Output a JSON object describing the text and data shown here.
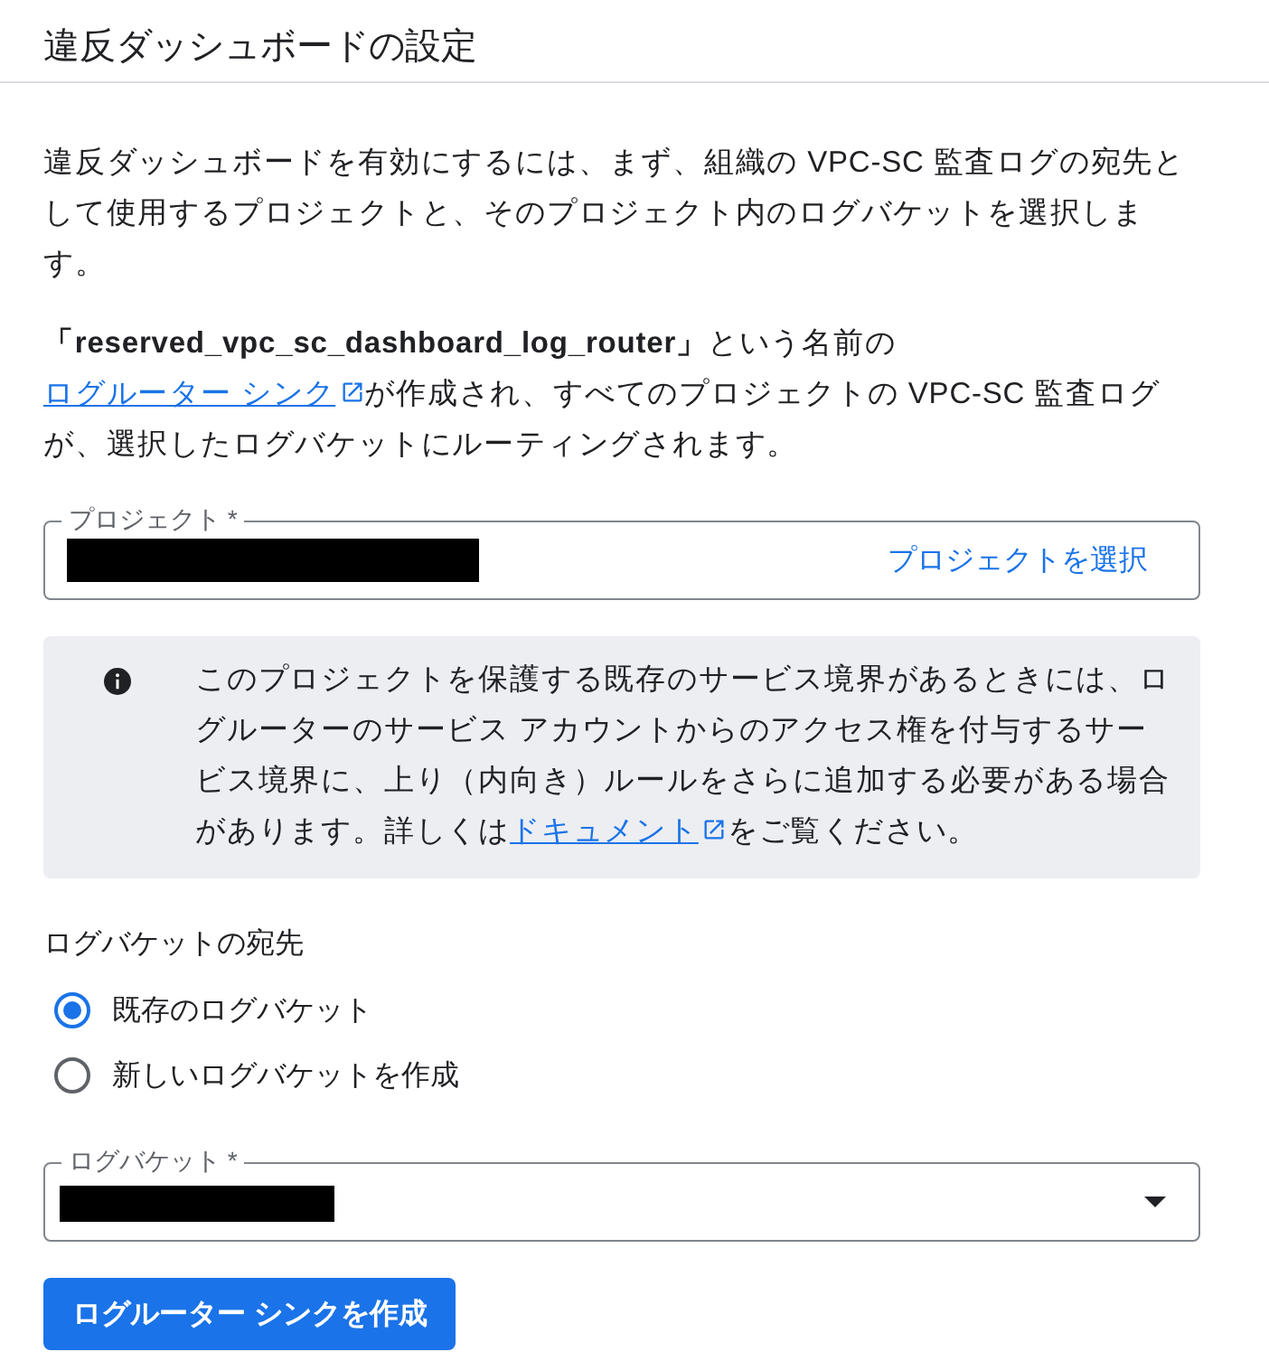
{
  "title": "違反ダッシュボードの設定",
  "intro": "違反ダッシュボードを有効にするには、まず、組織の VPC-SC 監査ログの宛先として使用するプロジェクトと、そのプロジェクト内のログバケットを選択します。",
  "sink_note": {
    "before": "**「reserved_vpc_sc_dashboard_log_router」**という名前の",
    "link": "ログルーター シンク",
    "after": "が作成され、すべてのプロジェクトの VPC-SC 監査ログが、選択したログバケットにルーティングされます。"
  },
  "project_field": {
    "label": "プロジェクト *",
    "value_redacted": true,
    "action": "プロジェクトを選択"
  },
  "info_box": {
    "before": "このプロジェクトを保護する既存のサービス境界があるときには、ログルーターのサービス アカウントからのアクセス権を付与するサービス境界に、上り（内向き）ルールをさらに追加する必要がある場合があります。詳しくは",
    "link": "ドキュメント",
    "after": "をご覧ください。"
  },
  "destination": {
    "heading": "ログバケットの宛先",
    "options": [
      {
        "label": "既存のログバケット",
        "selected": true
      },
      {
        "label": "新しいログバケットを作成",
        "selected": false
      }
    ]
  },
  "bucket_field": {
    "label": "ログバケット *",
    "value_redacted": true
  },
  "submit_button": "ログルーター シンクを作成"
}
